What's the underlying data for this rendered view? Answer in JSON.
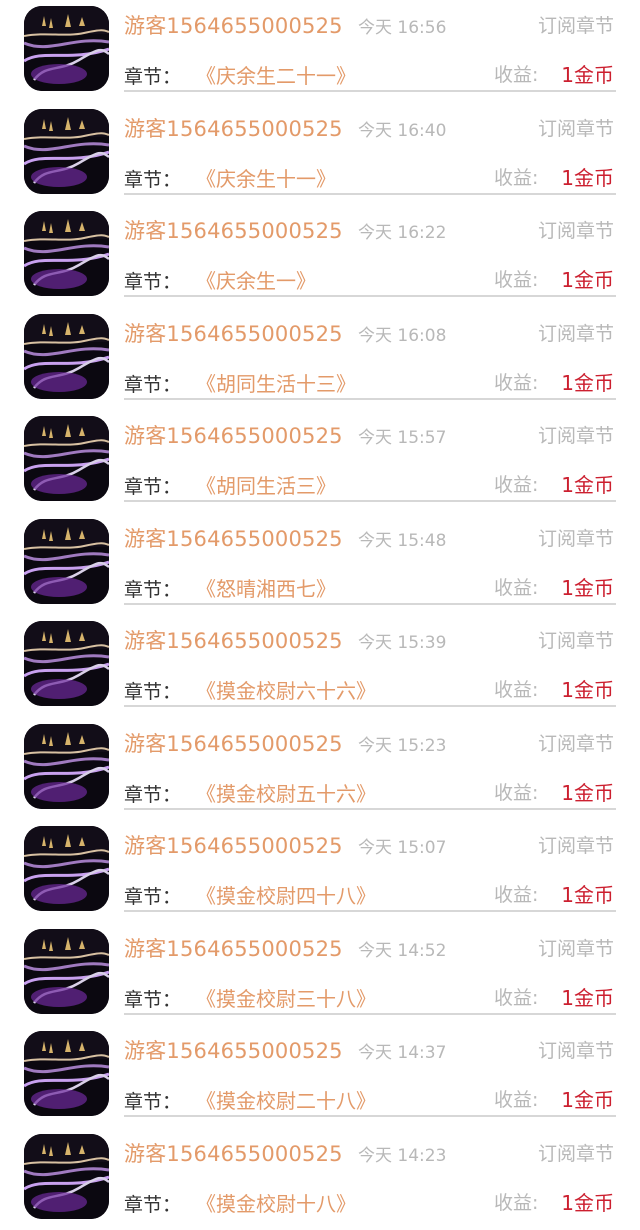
{
  "colors": {
    "accent_orange": "#e39a69",
    "income_red": "#cc1f2f",
    "muted_gray": "#b8b8b8",
    "divider": "#d7d7d7"
  },
  "records": [
    {
      "user": "游客1564655000525",
      "time": "今天 16:56",
      "action": "订阅章节",
      "chapter_label": "章节：",
      "chapter_title": "《庆余生二十一》",
      "income_label": "收益:",
      "income_value": "1金币",
      "avatar_icon": "avatar-night-bridge-icon"
    },
    {
      "user": "游客1564655000525",
      "time": "今天 16:40",
      "action": "订阅章节",
      "chapter_label": "章节：",
      "chapter_title": "《庆余生十一》",
      "income_label": "收益:",
      "income_value": "1金币",
      "avatar_icon": "avatar-night-bridge-icon"
    },
    {
      "user": "游客1564655000525",
      "time": "今天 16:22",
      "action": "订阅章节",
      "chapter_label": "章节：",
      "chapter_title": "《庆余生一》",
      "income_label": "收益:",
      "income_value": "1金币",
      "avatar_icon": "avatar-night-bridge-icon"
    },
    {
      "user": "游客1564655000525",
      "time": "今天 16:08",
      "action": "订阅章节",
      "chapter_label": "章节：",
      "chapter_title": "《胡同生活十三》",
      "income_label": "收益:",
      "income_value": "1金币",
      "avatar_icon": "avatar-night-bridge-icon"
    },
    {
      "user": "游客1564655000525",
      "time": "今天 15:57",
      "action": "订阅章节",
      "chapter_label": "章节：",
      "chapter_title": "《胡同生活三》",
      "income_label": "收益:",
      "income_value": "1金币",
      "avatar_icon": "avatar-night-bridge-icon"
    },
    {
      "user": "游客1564655000525",
      "time": "今天 15:48",
      "action": "订阅章节",
      "chapter_label": "章节：",
      "chapter_title": "《怒晴湘西七》",
      "income_label": "收益:",
      "income_value": "1金币",
      "avatar_icon": "avatar-night-bridge-icon"
    },
    {
      "user": "游客1564655000525",
      "time": "今天 15:39",
      "action": "订阅章节",
      "chapter_label": "章节：",
      "chapter_title": "《摸金校尉六十六》",
      "income_label": "收益:",
      "income_value": "1金币",
      "avatar_icon": "avatar-night-bridge-icon"
    },
    {
      "user": "游客1564655000525",
      "time": "今天 15:23",
      "action": "订阅章节",
      "chapter_label": "章节：",
      "chapter_title": "《摸金校尉五十六》",
      "income_label": "收益:",
      "income_value": "1金币",
      "avatar_icon": "avatar-night-bridge-icon"
    },
    {
      "user": "游客1564655000525",
      "time": "今天 15:07",
      "action": "订阅章节",
      "chapter_label": "章节：",
      "chapter_title": "《摸金校尉四十八》",
      "income_label": "收益:",
      "income_value": "1金币",
      "avatar_icon": "avatar-night-bridge-icon"
    },
    {
      "user": "游客1564655000525",
      "time": "今天 14:52",
      "action": "订阅章节",
      "chapter_label": "章节：",
      "chapter_title": "《摸金校尉三十八》",
      "income_label": "收益:",
      "income_value": "1金币",
      "avatar_icon": "avatar-night-bridge-icon"
    },
    {
      "user": "游客1564655000525",
      "time": "今天 14:37",
      "action": "订阅章节",
      "chapter_label": "章节：",
      "chapter_title": "《摸金校尉二十八》",
      "income_label": "收益:",
      "income_value": "1金币",
      "avatar_icon": "avatar-night-bridge-icon"
    },
    {
      "user": "游客1564655000525",
      "time": "今天 14:23",
      "action": "订阅章节",
      "chapter_label": "章节：",
      "chapter_title": "《摸金校尉十八》",
      "income_label": "收益:",
      "income_value": "1金币",
      "avatar_icon": "avatar-night-bridge-icon"
    }
  ]
}
